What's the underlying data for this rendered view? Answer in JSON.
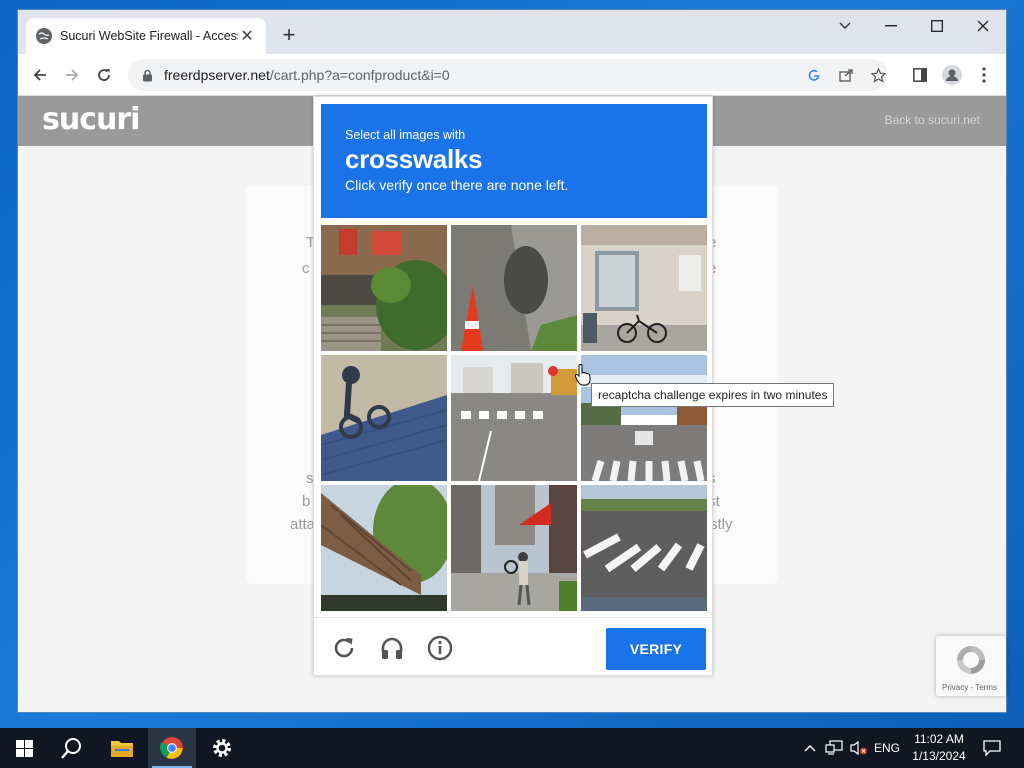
{
  "browser": {
    "tab_title": "Sucuri WebSite Firewall - Access",
    "tab_close": "✕",
    "new_tab": "+",
    "url_host": "freerdpserver.net",
    "url_path": "/cart.php?a=confproduct&i=0",
    "window_controls": [
      "chevron-down-icon",
      "minimize-icon",
      "maximize-icon",
      "close-icon"
    ]
  },
  "page": {
    "logo": "sucuri",
    "back_link": "Back to sucuri.net",
    "card_fragments": [
      "T",
      "e",
      "c",
      "e",
      "s",
      "s",
      "b",
      "st",
      "atta",
      "stly"
    ]
  },
  "captcha": {
    "instruction": "Select all images with",
    "target": "crosswalks",
    "sub_instruction": "Click verify once there are none left.",
    "verify_label": "VERIFY",
    "tiles": [
      "stairs-plants-tile",
      "traffic-cone-tile",
      "building-bicycle-tile",
      "shadow-cyclist-tile",
      "street-crosswalk-tile",
      "road-crosswalk-tile",
      "awning-tree-tile",
      "street-pedestrian-tile",
      "crosswalk-closeup-tile"
    ],
    "footer_icons": [
      "reload-icon",
      "headphones-icon",
      "info-icon"
    ]
  },
  "tooltip": "recaptcha challenge expires in two minutes",
  "recaptcha_badge": "Privacy - Terms",
  "taskbar": {
    "lang": "ENG",
    "time": "11:02 AM",
    "date": "1/13/2024"
  }
}
